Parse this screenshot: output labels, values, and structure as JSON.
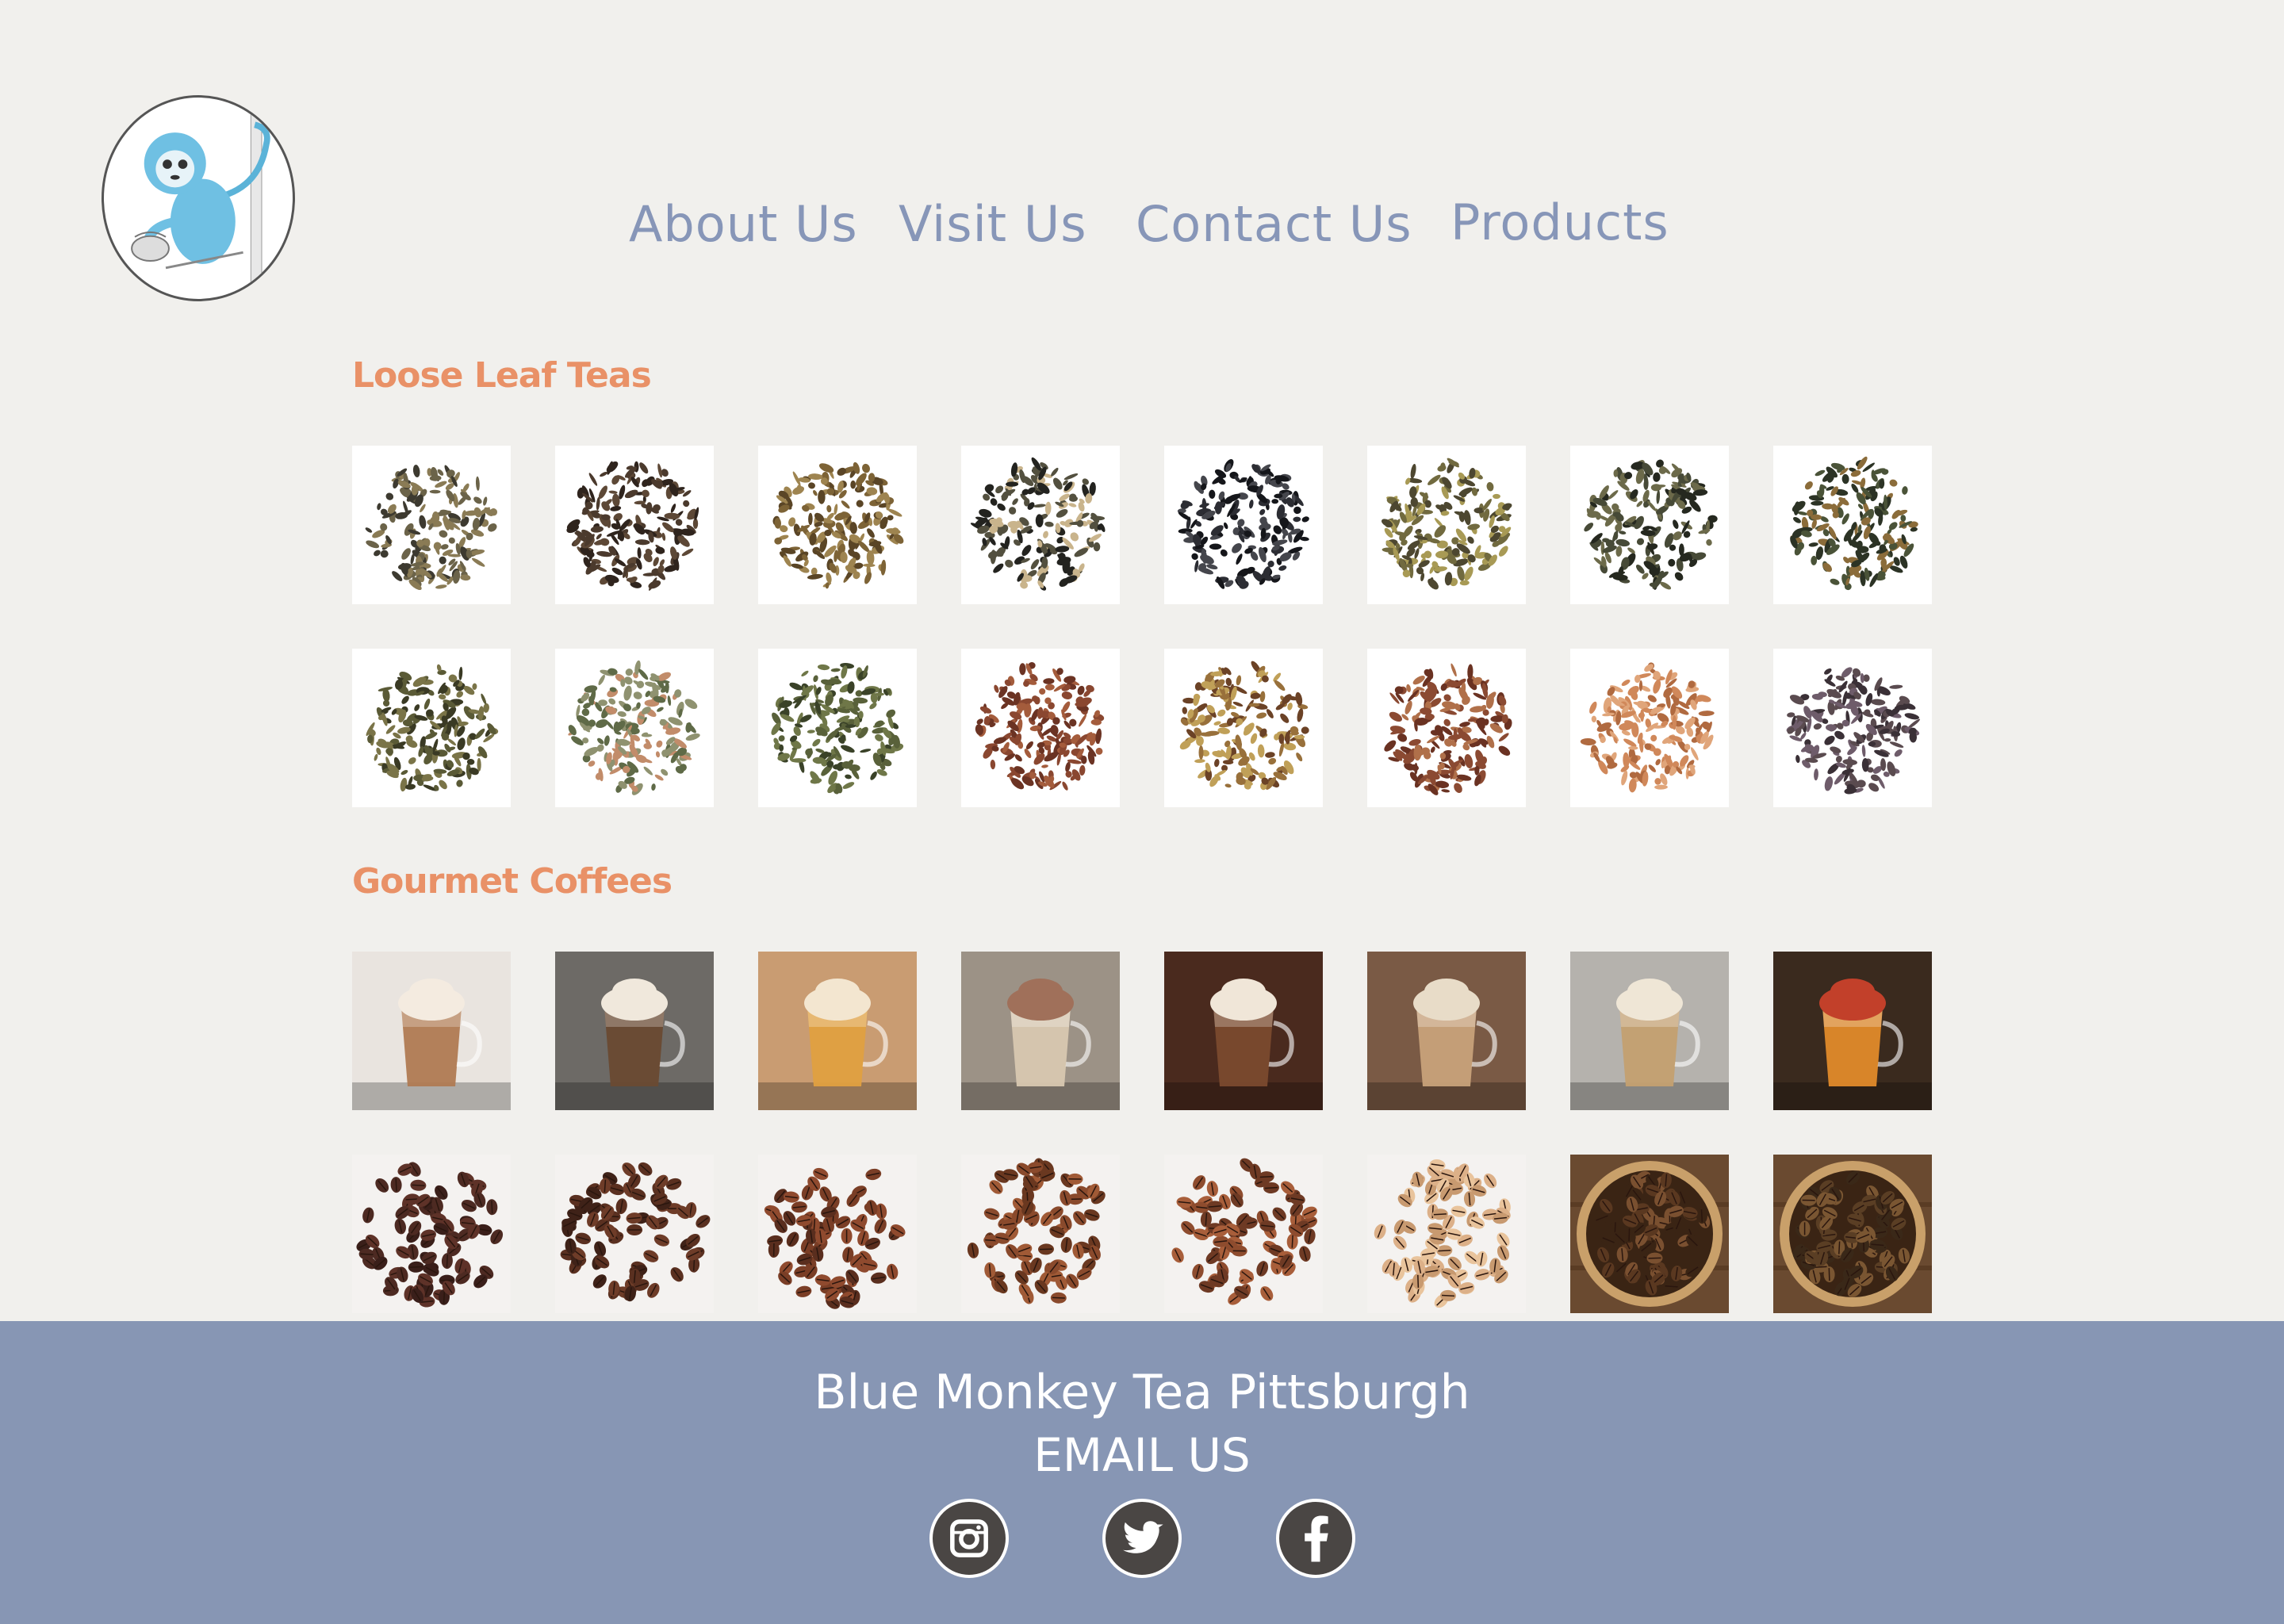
{
  "logo": {
    "icon": "blue-monkey-logo",
    "alt": "Blue Monkey Tea logo"
  },
  "nav": {
    "items": [
      {
        "label": "About Us"
      },
      {
        "label": "Visit Us"
      },
      {
        "label": "Contact Us"
      },
      {
        "label": "Products"
      }
    ]
  },
  "sections": [
    {
      "title": "Loose Leaf Teas",
      "rows": [
        [
          "tea-mixed-green",
          "tea-black-dark",
          "tea-pearls",
          "tea-almond-blend",
          "tea-black-fine",
          "tea-jasmine-green",
          "tea-citrus-black",
          "tea-green-peel"
        ],
        [
          "tea-green-leaf",
          "tea-white-blend",
          "tea-sencha",
          "tea-rooibos",
          "tea-rooibos-flower",
          "tea-rooibos-spice",
          "tea-honeybush",
          "tea-lavender-earl"
        ]
      ]
    },
    {
      "title": "Gourmet Coffees",
      "rows": [
        [
          "coffee-cream-latte",
          "coffee-mocha",
          "coffee-cinnamon",
          "coffee-chai",
          "coffee-copper-mug",
          "coffee-iced",
          "coffee-cappuccino",
          "coffee-cold-brew"
        ],
        [
          "beans-dark",
          "beans-french",
          "beans-medium",
          "beans-house",
          "beans-colombian",
          "beans-light",
          "beans-bowl-1",
          "beans-bowl-2"
        ]
      ]
    }
  ],
  "footer": {
    "title": "Blue Monkey Tea Pittsburgh",
    "email_label": "EMAIL US",
    "social": [
      {
        "icon": "instagram-icon"
      },
      {
        "icon": "twitter-icon"
      },
      {
        "icon": "facebook-icon"
      }
    ]
  },
  "colors": {
    "background": "#f1f0ed",
    "nav_text": "#8796b8",
    "section_title": "#e99167",
    "footer_bg": "#8796b4",
    "social_bg": "#4a4644"
  }
}
